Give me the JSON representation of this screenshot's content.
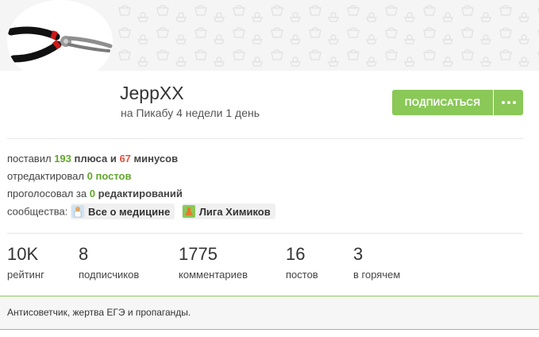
{
  "profile": {
    "username": "JeppXX",
    "member_since": "на Пикабу 4 недели 1 день"
  },
  "actions": {
    "subscribe_label": "ПОДПИСАТЬСЯ",
    "more_icon": "more-dots-icon"
  },
  "activity": {
    "plus_prefix": "поставил",
    "plus_count": "193",
    "plus_word": "плюса",
    "and_word": "и",
    "minus_count": "67",
    "minus_word": "минусов",
    "edited_prefix": "отредактировал",
    "edited_count": "0",
    "edited_word": "постов",
    "voted_prefix": "проголосовал за",
    "voted_count": "0",
    "voted_word": "редактирований",
    "communities_label": "сообщества:",
    "communities": [
      {
        "name": "Все о медицине",
        "icon": "medicine-community-icon"
      },
      {
        "name": "Лига Химиков",
        "icon": "chemistry-community-icon"
      }
    ]
  },
  "stats": [
    {
      "value": "10K",
      "label": "рейтинг"
    },
    {
      "value": "8",
      "label": "подписчиков"
    },
    {
      "value": "1775",
      "label": "комментариев"
    },
    {
      "value": "16",
      "label": "постов"
    },
    {
      "value": "3",
      "label": "в горячем"
    }
  ],
  "about": "Антисоветчик, жертва ЕГЭ и пропаганды.",
  "colors": {
    "accent": "#8ac858",
    "plus": "#62a62d",
    "minus": "#e15040"
  }
}
